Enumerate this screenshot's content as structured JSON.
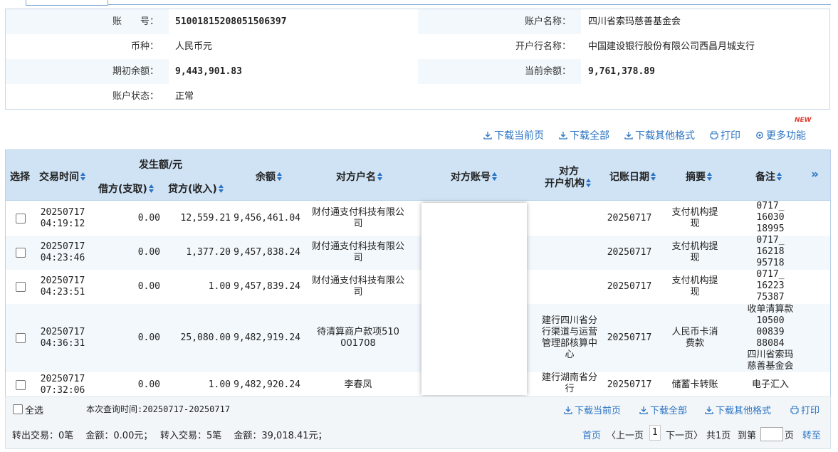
{
  "account": {
    "account_no_label": "账　　号：",
    "account_no": "51001815208051506397",
    "account_name_label": "账户名称：",
    "account_name": "四川省索玛慈善基金会",
    "currency_label": "币种：",
    "currency": "人民币元",
    "bank_label": "开户行名称：",
    "bank": "中国建设银行股份有限公司西昌月城支行",
    "opening_balance_label": "期初余额：",
    "opening_balance": "9,443,901.83",
    "current_balance_label": "当前余额：",
    "current_balance": "9,761,378.89",
    "status_label": "账户状态：",
    "status": "正常"
  },
  "actions": {
    "download_current": "下载当前页",
    "download_all": "下载全部",
    "download_other": "下载其他格式",
    "print": "打印",
    "more": "更多功能",
    "new_badge": "NEW"
  },
  "table": {
    "headers": {
      "select": "选择",
      "time": "交易时间",
      "amount_group": "发生额/元",
      "debit": "借方(支取)",
      "credit": "贷方(收入)",
      "balance": "余额",
      "counterparty_name": "对方户名",
      "counterparty_account": "对方账号",
      "counterparty_bank_line1": "对方",
      "counterparty_bank_line2": "开户机构",
      "posting_date": "记账日期",
      "summary": "摘要",
      "remark": "备注",
      "more": "»"
    },
    "rows": [
      {
        "date": "20250717",
        "time": "04:19:12",
        "debit": "0.00",
        "credit": "12,559.21",
        "balance": "9,456,461.04",
        "name1": "财付通支付科技有限公",
        "name2": "司",
        "bank": [],
        "post": "20250717",
        "summary": [
          "支付机构提",
          "现"
        ],
        "remark": [
          "0717_",
          "16030",
          "18995"
        ]
      },
      {
        "date": "20250717",
        "time": "04:23:46",
        "debit": "0.00",
        "credit": "1,377.20",
        "balance": "9,457,838.24",
        "name1": "财付通支付科技有限公",
        "name2": "司",
        "bank": [],
        "post": "20250717",
        "summary": [
          "支付机构提",
          "现"
        ],
        "remark": [
          "0717_",
          "16218",
          "95718"
        ]
      },
      {
        "date": "20250717",
        "time": "04:23:51",
        "debit": "0.00",
        "credit": "1.00",
        "balance": "9,457,839.24",
        "name1": "财付通支付科技有限公",
        "name2": "司",
        "bank": [],
        "post": "20250717",
        "summary": [
          "支付机构提",
          "现"
        ],
        "remark": [
          "0717_",
          "16223",
          "75387"
        ]
      },
      {
        "date": "20250717",
        "time": "04:36:31",
        "debit": "0.00",
        "credit": "25,080.00",
        "balance": "9,482,919.24",
        "name1": "待清算商户款项510",
        "name2": "001708",
        "bank": [
          "建行四川省分",
          "行渠道与运营",
          "管理部核算中",
          "心"
        ],
        "post": "20250717",
        "summary": [
          "人民币卡消",
          "费款"
        ],
        "remark": [
          "收单清算款",
          "10500",
          "00839",
          "88084",
          "四川省索玛",
          "慈善基金会"
        ]
      },
      {
        "date": "20250717",
        "time": "07:32:06",
        "debit": "0.00",
        "credit": "1.00",
        "balance": "9,482,920.24",
        "name1": "李春凤",
        "name2": "",
        "bank": [
          "建行湖南省分",
          "行"
        ],
        "post": "20250717",
        "summary": [
          "储蓄卡转账"
        ],
        "remark": [
          "电子汇入"
        ]
      }
    ]
  },
  "footer": {
    "select_all": "全选",
    "query_time": "本次查询时间:20250717-20250717",
    "download_current": "下载当前页",
    "download_all": "下载全部",
    "download_other": "下载其他格式",
    "print": "打印",
    "summary_text": "转出交易：0笔　 金额：0.00元；　 转入交易：5笔　 金额：39,018.41元；",
    "first": "首页",
    "prev": "〈上一页",
    "page": "1",
    "next": "下一页〉",
    "total": "共1页",
    "goto": "到第",
    "page_unit": "页",
    "go": "转至"
  },
  "colors": {
    "link": "#2a73c2",
    "header_bg": "#cfe3f5",
    "alt_row": "#f3f8fc",
    "new_badge": "#e23b2e"
  }
}
